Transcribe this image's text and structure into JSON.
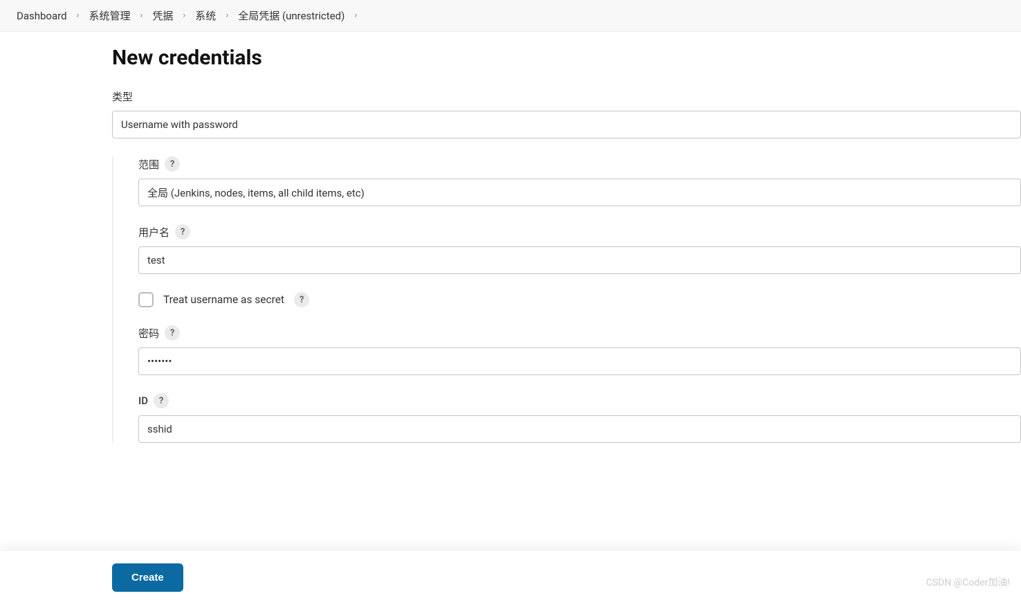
{
  "breadcrumb": {
    "items": [
      {
        "label": "Dashboard"
      },
      {
        "label": "系统管理"
      },
      {
        "label": "凭据"
      },
      {
        "label": "系统"
      },
      {
        "label": "全局凭据 (unrestricted)"
      }
    ]
  },
  "page_title": "New credentials",
  "form": {
    "kind": {
      "label": "类型",
      "value": "Username with password"
    },
    "scope": {
      "label": "范围",
      "value": "全局 (Jenkins, nodes, items, all child items, etc)"
    },
    "username": {
      "label": "用户名",
      "value": "test"
    },
    "treat_secret": {
      "label": "Treat username as secret",
      "checked": false
    },
    "password": {
      "label": "密码",
      "value": "•••••••"
    },
    "id": {
      "label": "ID",
      "value": "sshid"
    }
  },
  "buttons": {
    "create": "Create"
  },
  "watermark": "CSDN @Coder加油!",
  "help_glyph": "?"
}
